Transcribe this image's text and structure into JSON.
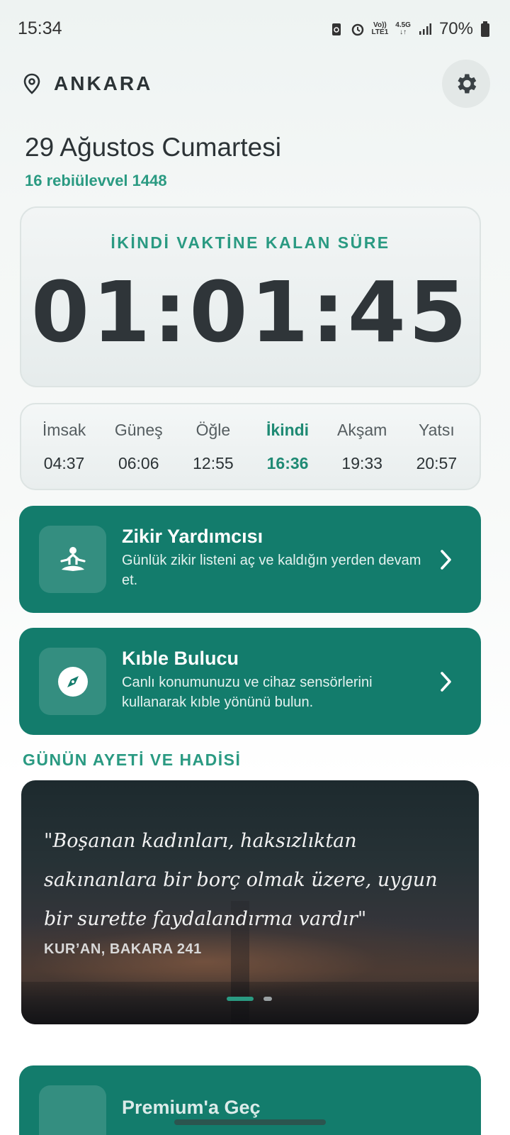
{
  "status_bar": {
    "time": "15:34",
    "network_top": "Vo))",
    "network_bottom": "LTE1",
    "data_type": "4.5G",
    "battery": "70%"
  },
  "header": {
    "city": "ANKARA"
  },
  "date": {
    "gregorian": "29 Ağustos Cumartesi",
    "hijri": "16 rebiülevvel 1448"
  },
  "countdown": {
    "label": "İKİNDİ VAKTİNE KALAN SÜRE",
    "value": "01:01:45"
  },
  "prayer_times": [
    {
      "name": "İmsak",
      "time": "04:37"
    },
    {
      "name": "Güneş",
      "time": "06:06"
    },
    {
      "name": "Öğle",
      "time": "12:55"
    },
    {
      "name": "İkindi",
      "time": "16:36"
    },
    {
      "name": "Akşam",
      "time": "19:33"
    },
    {
      "name": "Yatsı",
      "time": "20:57"
    }
  ],
  "features": {
    "zikir": {
      "title": "Zikir Yardımcısı",
      "desc": "Günlük zikir listeni aç ve kaldığın yerden devam et."
    },
    "kible": {
      "title": "Kıble Bulucu",
      "desc": "Canlı konumunuzu ve cihaz sensörlerini kullanarak kıble yönünü bulun."
    }
  },
  "verse_section": {
    "title": "GÜNÜN AYETİ VE HADİSİ",
    "text": "\"Boşanan kadınları, haksızlıktan sakınanlara bir borç olmak üzere, uygun bir surette faydalandırma vardır\"",
    "source": "KUR’AN, BAKARA 241"
  },
  "premium": {
    "title": "Premium'a Geç"
  },
  "colors": {
    "accent": "#2a9a82",
    "card_green": "#137c6c"
  }
}
